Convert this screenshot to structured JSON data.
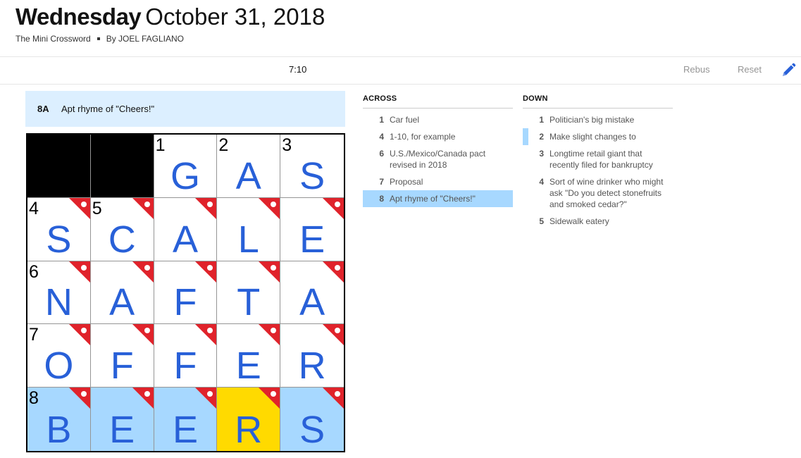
{
  "header": {
    "day": "Wednesday",
    "date": "October 31, 2018",
    "puzzle_name": "The Mini Crossword",
    "byline": "By JOEL FAGLIANO"
  },
  "toolbar": {
    "timer": "7:10",
    "rebus_label": "Rebus",
    "reset_label": "Reset",
    "pencil_icon": "pencil-icon"
  },
  "current_clue": {
    "label": "8A",
    "text": "Apt rhyme of \"Cheers!\""
  },
  "board": {
    "rows": [
      [
        {
          "black": true
        },
        {
          "black": true
        },
        {
          "num": "1",
          "letter": "G"
        },
        {
          "num": "2",
          "letter": "A"
        },
        {
          "num": "3",
          "letter": "S"
        }
      ],
      [
        {
          "num": "4",
          "letter": "S",
          "flag": true
        },
        {
          "num": "5",
          "letter": "C",
          "flag": true
        },
        {
          "letter": "A",
          "flag": true
        },
        {
          "letter": "L",
          "flag": true
        },
        {
          "letter": "E",
          "flag": true
        }
      ],
      [
        {
          "num": "6",
          "letter": "N",
          "flag": true
        },
        {
          "letter": "A",
          "flag": true
        },
        {
          "letter": "F",
          "flag": true
        },
        {
          "letter": "T",
          "flag": true
        },
        {
          "letter": "A",
          "flag": true
        }
      ],
      [
        {
          "num": "7",
          "letter": "O",
          "flag": true
        },
        {
          "letter": "F",
          "flag": true
        },
        {
          "letter": "F",
          "flag": true
        },
        {
          "letter": "E",
          "flag": true
        },
        {
          "letter": "R",
          "flag": true
        }
      ],
      [
        {
          "num": "8",
          "letter": "B",
          "flag": true,
          "state": "hl"
        },
        {
          "letter": "E",
          "flag": true,
          "state": "hl"
        },
        {
          "letter": "E",
          "flag": true,
          "state": "hl"
        },
        {
          "letter": "R",
          "flag": true,
          "state": "sel"
        },
        {
          "letter": "S",
          "flag": true,
          "state": "hl"
        }
      ]
    ],
    "colors": {
      "highlight": "#a7d8ff",
      "selected": "#ffda00",
      "flag": "#e0232b",
      "letter": "#2860d8"
    }
  },
  "across": {
    "title": "ACROSS",
    "clues": [
      {
        "num": "1",
        "text": "Car fuel"
      },
      {
        "num": "4",
        "text": "1-10, for example"
      },
      {
        "num": "6",
        "text": "U.S./Mexico/Canada pact revised in 2018"
      },
      {
        "num": "7",
        "text": "Proposal"
      },
      {
        "num": "8",
        "text": "Apt rhyme of \"Cheers!\"",
        "active": true
      }
    ]
  },
  "down": {
    "title": "DOWN",
    "clues": [
      {
        "num": "1",
        "text": "Politician's big mistake"
      },
      {
        "num": "2",
        "text": "Make slight changes to",
        "cross": true
      },
      {
        "num": "3",
        "text": "Longtime retail giant that recently filed for bankruptcy"
      },
      {
        "num": "4",
        "text": "Sort of wine drinker who might ask \"Do you detect stonefruits and smoked cedar?\""
      },
      {
        "num": "5",
        "text": "Sidewalk eatery"
      }
    ]
  }
}
